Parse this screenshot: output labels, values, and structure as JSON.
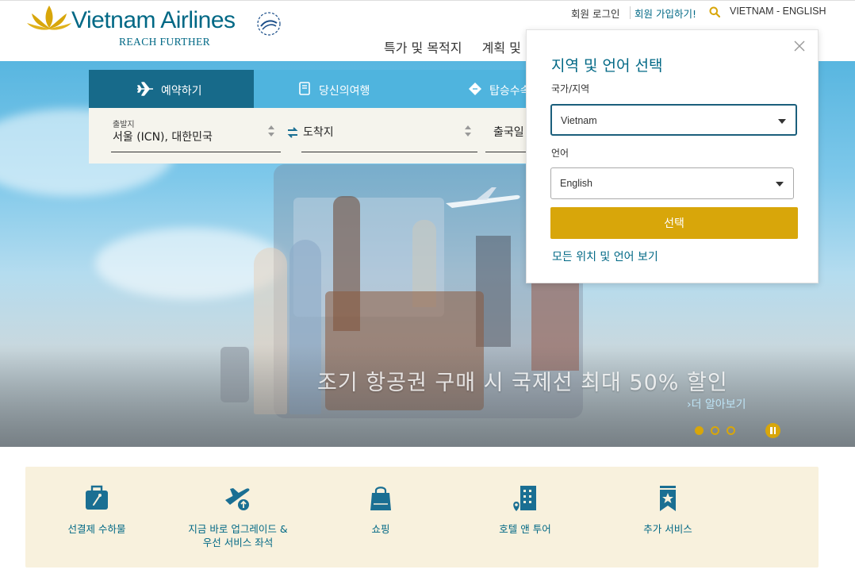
{
  "brand": {
    "name": "Vietnam Airlines",
    "tagline": "REACH FURTHER",
    "color": "#006885",
    "accent": "#d8a60a"
  },
  "toplinks": {
    "login": "회원 로그인",
    "join": "회원 가입하기!",
    "region": "VIETNAM - ENGLISH"
  },
  "mainnav": {
    "items": [
      "특가 및 목적지",
      "계획 및"
    ]
  },
  "booking": {
    "tabs": [
      {
        "label": "예약하기",
        "icon": "airplane-icon"
      },
      {
        "label": "당신의여행",
        "icon": "book-icon"
      },
      {
        "label": "탑승수속",
        "icon": "ticket-icon"
      }
    ],
    "from_label": "출발지",
    "from_value": "서울 (ICN), 대한민국",
    "to_placeholder": "도착지",
    "date_placeholder": "출국일"
  },
  "hero": {
    "headline": "조기 항공권 구매 시 국제선 최대 50% 할인",
    "more_link": "›더 알아보기",
    "slide_count": 3,
    "active_slide": 1
  },
  "region_panel": {
    "title": "지역 및 언어 선택",
    "country_label": "국가/지역",
    "country_value": "Vietnam",
    "language_label": "언어",
    "language_value": "English",
    "submit_label": "선택",
    "all_locations_link": "모든 위치 및 언어 보기"
  },
  "services": [
    {
      "label_lines": [
        "선결제 수하물"
      ],
      "icon": "luggage-icon"
    },
    {
      "label_lines": [
        "지금 바로 업그레이드 &",
        "우선 서비스 좌석"
      ],
      "icon": "plane-upgrade-icon"
    },
    {
      "label_lines": [
        "쇼핑"
      ],
      "icon": "shopping-bag-icon"
    },
    {
      "label_lines": [
        "호텔 앤 투어"
      ],
      "icon": "hotel-icon"
    },
    {
      "label_lines": [
        "추가 서비스"
      ],
      "icon": "bookmark-star-icon"
    }
  ]
}
